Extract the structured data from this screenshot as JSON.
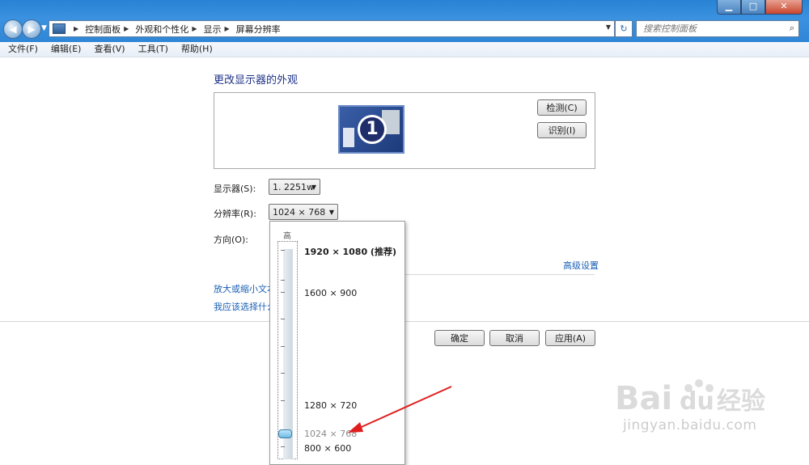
{
  "window": {
    "minimize": "▁",
    "maximize": "□",
    "close": "✕"
  },
  "address": {
    "crumbs": [
      "控制面板",
      "外观和个性化",
      "显示",
      "屏幕分辨率"
    ]
  },
  "search": {
    "placeholder": "搜索控制面板"
  },
  "menu": [
    "文件(F)",
    "编辑(E)",
    "查看(V)",
    "工具(T)",
    "帮助(H)"
  ],
  "page_title": "更改显示器的外观",
  "preview": {
    "monitor_number": "1",
    "detect_label": "检测(C)",
    "identify_label": "识别(I)"
  },
  "settings": {
    "display_label": "显示器(S):",
    "display_value": "1. 2251w",
    "resolution_label": "分辨率(R):",
    "resolution_value": "1024 × 768",
    "orientation_label": "方向(O):",
    "advanced_link": "高级设置",
    "text_size_link": "放大或缩小文本",
    "which_link": "我应该选择什么"
  },
  "buttons": {
    "ok": "确定",
    "cancel": "取消",
    "apply": "应用(A)"
  },
  "dropdown": {
    "high_label": "高",
    "options": [
      "1920 × 1080 (推荐)",
      "1600 × 900",
      "1280 × 720",
      "1024 × 768",
      "800 × 600"
    ],
    "selected": "1024 × 768"
  },
  "watermark": {
    "logo": "Baidu经验",
    "url": "jingyan.baidu.com"
  },
  "colors": {
    "titlebar": "#2f86d6",
    "link": "#1a5fb4",
    "arrow": "#e01e1e"
  }
}
